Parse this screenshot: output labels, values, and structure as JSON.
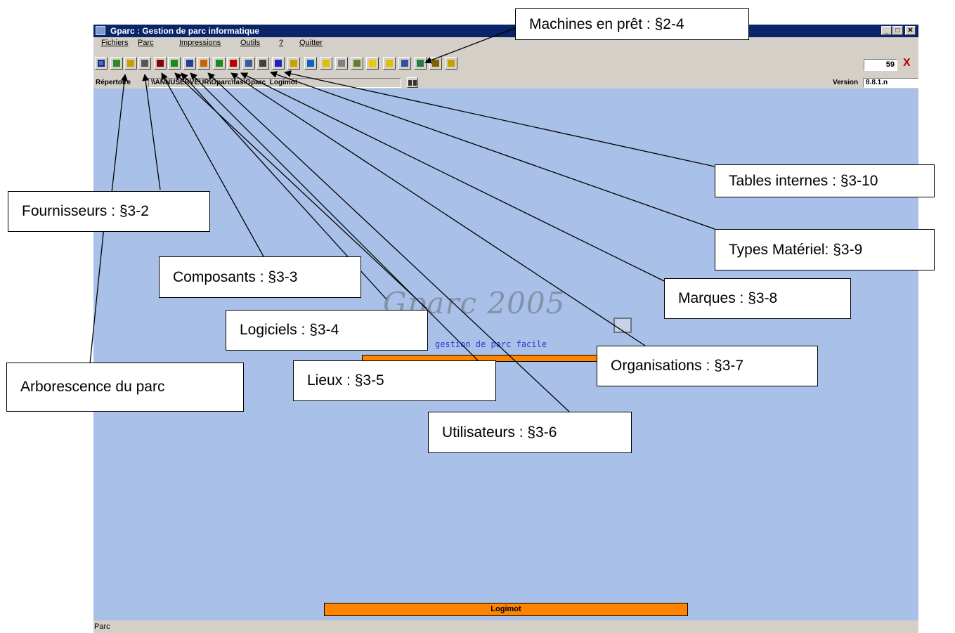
{
  "window": {
    "title": "Gparc : Gestion de parc informatique",
    "caption_buttons": [
      "_",
      "□",
      "✕"
    ]
  },
  "menu": {
    "items": [
      "Fichiers",
      "Parc",
      "Impressions",
      "Outils",
      "?",
      "Quitter"
    ]
  },
  "toolbar": {
    "icons": [
      {
        "name": "tree-icon",
        "color": "#2b8a2b"
      },
      {
        "name": "supplier-icon",
        "color": "#c8a000"
      },
      {
        "name": "people-icon",
        "color": "#555555"
      },
      {
        "name": "component-icon",
        "color": "#8b0000"
      },
      {
        "name": "software-icon",
        "color": "#1a8a1a"
      },
      {
        "name": "location-icon",
        "color": "#2040a0"
      },
      {
        "name": "user-icon",
        "color": "#c86400"
      },
      {
        "name": "organisation-icon",
        "color": "#1a8a1a"
      },
      {
        "name": "brand-icon",
        "color": "#c00000"
      },
      {
        "name": "equipment-type-icon",
        "color": "#3060a0"
      },
      {
        "name": "internal-tables-icon",
        "color": "#404040"
      },
      {
        "name": "wizard-icon",
        "color": "#2020c0"
      },
      {
        "name": "lock-icon",
        "color": "#c8a000"
      },
      {
        "name": "clock-icon",
        "color": "#1060c0"
      },
      {
        "name": "new-folder-icon",
        "color": "#e0c000"
      },
      {
        "name": "edit-icon",
        "color": "#808080"
      },
      {
        "name": "loan-icon",
        "color": "#608030"
      },
      {
        "name": "folder-icon",
        "color": "#f0c800"
      },
      {
        "name": "cube-icon",
        "color": "#e0c000"
      },
      {
        "name": "pen-icon",
        "color": "#3050a0"
      },
      {
        "name": "calculator-icon",
        "color": "#208040"
      },
      {
        "name": "sound-icon",
        "color": "#806000"
      },
      {
        "name": "help-icon",
        "color": "#c8a000"
      }
    ],
    "count": "59",
    "close_symbol": "X"
  },
  "directory": {
    "label": "Répertoire",
    "path": "\\\\ANNUSERVEUR\\Gparc\\fas\\Gparc_Logimot",
    "version_label": "Version",
    "version": "8.8.1.n"
  },
  "splash": {
    "logo": "Gparc 2005",
    "subtitle": "gestion de parc facile",
    "company": "Logimot"
  },
  "status": {
    "text": "Parc"
  },
  "callouts": {
    "machines": "Machines en prêt : §2-4",
    "tables": "Tables internes : §3-10",
    "fournisseurs": "Fournisseurs : §3-2",
    "types": "Types Matériel: §3-9",
    "composants": "Composants : §3-3",
    "marques": "Marques : §3-8",
    "logiciels": "Logiciels : §3-4",
    "organisations": "Organisations : §3-7",
    "arborescence": "Arborescence du parc",
    "lieux": "Lieux : §3-5",
    "utilisateurs": "Utilisateurs : §3-6"
  },
  "colors": {
    "desktop": "#a9c0e8",
    "titlebar": "#0a246a",
    "accent": "#ff8400"
  }
}
